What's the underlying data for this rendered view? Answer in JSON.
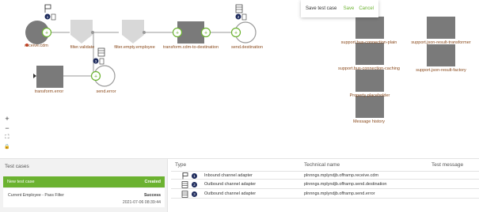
{
  "save_dialog": {
    "title": "Save test case",
    "save_label": "Save",
    "cancel_label": "Cancel"
  },
  "flow": {
    "nodes": [
      {
        "id": "n1",
        "label": "receive.cdm"
      },
      {
        "id": "n2",
        "label": "filter.validate"
      },
      {
        "id": "n3",
        "label": "filter.empty.employee"
      },
      {
        "id": "n4",
        "label": "transform.cdm-to-destination"
      },
      {
        "id": "n5",
        "label": "send.destination"
      },
      {
        "id": "n6",
        "label": "transform.error"
      },
      {
        "id": "n7",
        "label": "send.error"
      }
    ],
    "badges": [
      "1",
      "2",
      "3"
    ],
    "resources": [
      "support.bus-connection-plain",
      "support.json-result-transformer",
      "support.bus-connection-caching",
      "support.json-result-factory",
      "Property placeholder",
      "Message history"
    ]
  },
  "canvas_tools": {
    "zoom_in": "+",
    "zoom_out": "−",
    "fit": "⛶",
    "lock": "🔒"
  },
  "test_cases": {
    "title": "Test cases",
    "new_label": "New test case",
    "new_status": "Created",
    "items": [
      {
        "name": "Current Employee - Pass Filter",
        "status": "Success",
        "date": "2021-07-06 08:39:44"
      }
    ]
  },
  "steps": {
    "columns": {
      "type": "Type",
      "technical_name": "Technical name",
      "test_message": "Test message"
    },
    "rows": [
      {
        "num": "1",
        "icon": "flag-icon",
        "type": "Inbound channel adapter",
        "technical_name": "plnnngs.mplyndjb.offramp.receive.cdm",
        "test_message": ""
      },
      {
        "num": "2",
        "icon": "ladder-icon",
        "type": "Outbound channel adapter",
        "technical_name": "plnnngs.mplyndjb.offramp.send.destination",
        "test_message": ""
      },
      {
        "num": "3",
        "icon": "ladder-icon",
        "type": "Outbound channel adapter",
        "technical_name": "plnnngs.mplyndjb.offramp.send.error",
        "test_message": ""
      }
    ]
  },
  "colors": {
    "accent": "#6bb230",
    "badge": "#1d2a5c",
    "node": "#7a7a7a",
    "label": "#8a4a1c"
  }
}
